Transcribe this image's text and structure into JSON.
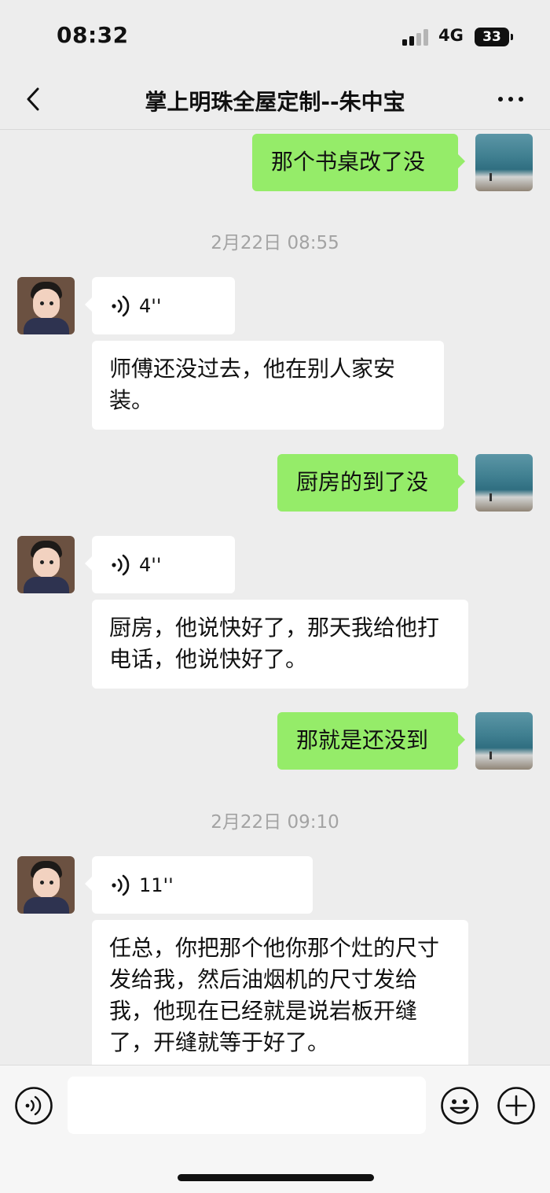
{
  "status_bar": {
    "time": "08:32",
    "network": "4G",
    "battery": "33"
  },
  "header": {
    "title": "掌上明珠全屋定制--朱中宝",
    "back_icon": "chevron-left-icon",
    "more_icon": "more-dots-icon"
  },
  "colors": {
    "sent_bubble": "#95ec69",
    "received_bubble": "#ffffff",
    "background": "#ededed"
  },
  "messages": [
    {
      "from": "me",
      "type": "text",
      "text": "那个书桌改了没"
    },
    {
      "type": "timestamp",
      "text": "2月22日 08:55"
    },
    {
      "from": "other",
      "type": "voice",
      "duration": "4''"
    },
    {
      "from": "other",
      "type": "text",
      "text": "师傅还没过去，他在别人家安装。"
    },
    {
      "from": "me",
      "type": "text",
      "text": "厨房的到了没"
    },
    {
      "from": "other",
      "type": "voice",
      "duration": "4''"
    },
    {
      "from": "other",
      "type": "text",
      "text": "厨房，他说快好了，那天我给他打电话，他说快好了。"
    },
    {
      "from": "me",
      "type": "text",
      "text": "那就是还没到"
    },
    {
      "type": "timestamp",
      "text": "2月22日 09:10"
    },
    {
      "from": "other",
      "type": "voice",
      "duration": "11''"
    },
    {
      "from": "other",
      "type": "text",
      "text": "任总，你把那个他你那个灶的尺寸发给我，然后油烟机的尺寸发给我，他现在已经就是说岩板开缝了，开缝就等于好了。"
    }
  ],
  "input_bar": {
    "voice_icon": "voice-input-icon",
    "emoji_icon": "emoji-icon",
    "plus_icon": "plus-icon"
  }
}
